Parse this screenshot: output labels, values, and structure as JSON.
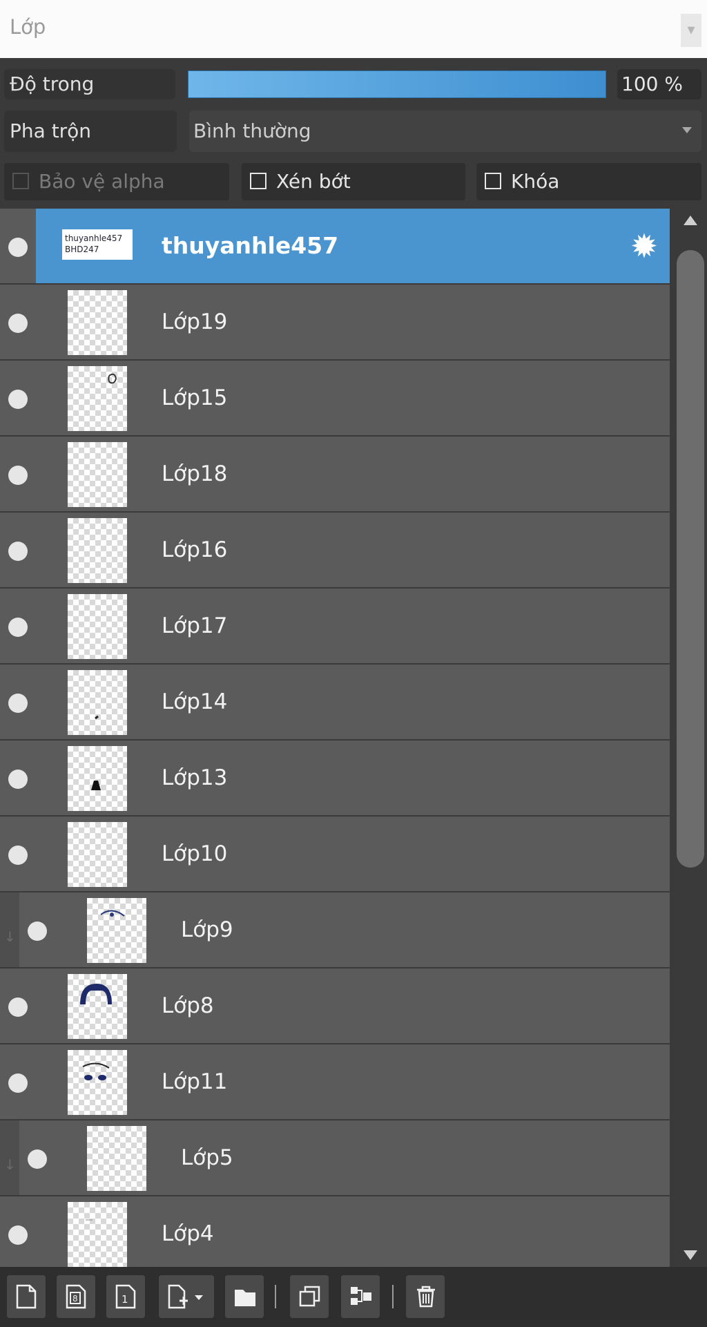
{
  "panel": {
    "title": "Lớp"
  },
  "opacity": {
    "label": "Độ trong",
    "value_text": "100 %",
    "value": 100
  },
  "blend": {
    "label": "Pha trộn",
    "selected": "Bình thường"
  },
  "checkboxes": {
    "protect_alpha": "Bảo vệ alpha",
    "clip": "Xén bớt",
    "lock": "Khóa"
  },
  "layers": [
    {
      "name": "thuyanhle457",
      "selected": true,
      "thumb_text": "thuyanhle457 BHD247"
    },
    {
      "name": "Lớp19"
    },
    {
      "name": "Lớp15"
    },
    {
      "name": "Lớp18"
    },
    {
      "name": "Lớp16"
    },
    {
      "name": "Lớp17"
    },
    {
      "name": "Lớp14"
    },
    {
      "name": "Lớp13"
    },
    {
      "name": "Lớp10"
    },
    {
      "name": "Lớp9",
      "clipped": true
    },
    {
      "name": "Lớp8"
    },
    {
      "name": "Lớp11"
    },
    {
      "name": "Lớp5",
      "clipped": true
    },
    {
      "name": "Lớp4"
    }
  ],
  "colors": {
    "selected": "#4a95d0",
    "row": "#5b5b5b",
    "slider": "#4fa0de"
  },
  "toolbar": {
    "icons": [
      "new-layer-icon",
      "new-8bit-layer-icon",
      "new-1bit-layer-icon",
      "add-special-layer-icon",
      "folder-icon",
      "duplicate-layer-icon",
      "merge-down-icon",
      "delete-layer-icon"
    ]
  }
}
